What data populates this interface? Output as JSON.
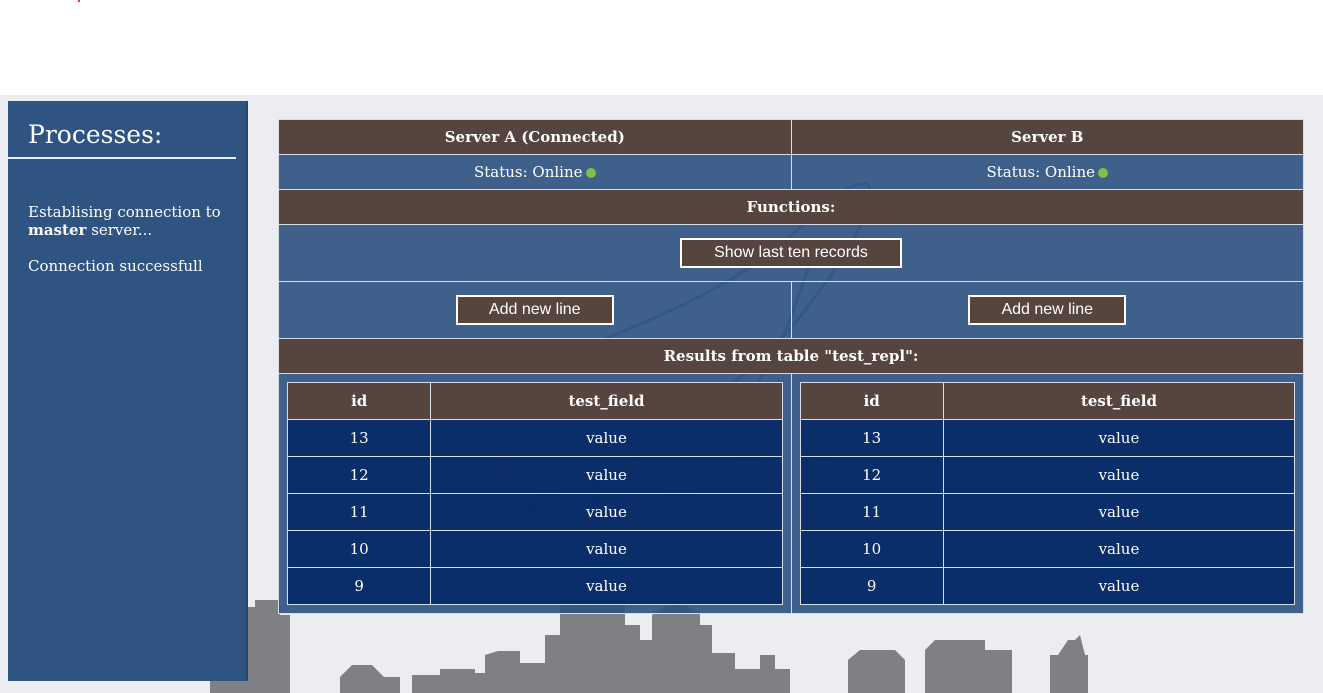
{
  "sidebar": {
    "title": "Processes:",
    "log_line1_prefix": "Establising connection to",
    "log_line1_bold": "master",
    "log_line1_suffix": " server...",
    "log_line2": "Connection successfull"
  },
  "servers": {
    "a": {
      "name": "Server A (Connected)",
      "status": "Status: Online"
    },
    "b": {
      "name": "Server B",
      "status": "Status: Online"
    },
    "status_color": "#7cc142"
  },
  "functions": {
    "heading": "Functions:",
    "show_last_ten": "Show last ten records",
    "add_new_line_a": "Add new line",
    "add_new_line_b": "Add new line"
  },
  "results": {
    "heading": "Results from table \"test_repl\":",
    "columns": [
      "id",
      "test_field"
    ],
    "a": [
      [
        "13",
        "value"
      ],
      [
        "12",
        "value"
      ],
      [
        "11",
        "value"
      ],
      [
        "10",
        "value"
      ],
      [
        "9",
        "value"
      ]
    ],
    "b": [
      [
        "13",
        "value"
      ],
      [
        "12",
        "value"
      ],
      [
        "11",
        "value"
      ],
      [
        "10",
        "value"
      ],
      [
        "9",
        "value"
      ]
    ]
  },
  "colors": {
    "header_brown": "#56443f",
    "panel_blue": "#2f5482",
    "row_navy": "#072b67",
    "background": "#ebedf0"
  },
  "watermark_text": "MariaDB"
}
